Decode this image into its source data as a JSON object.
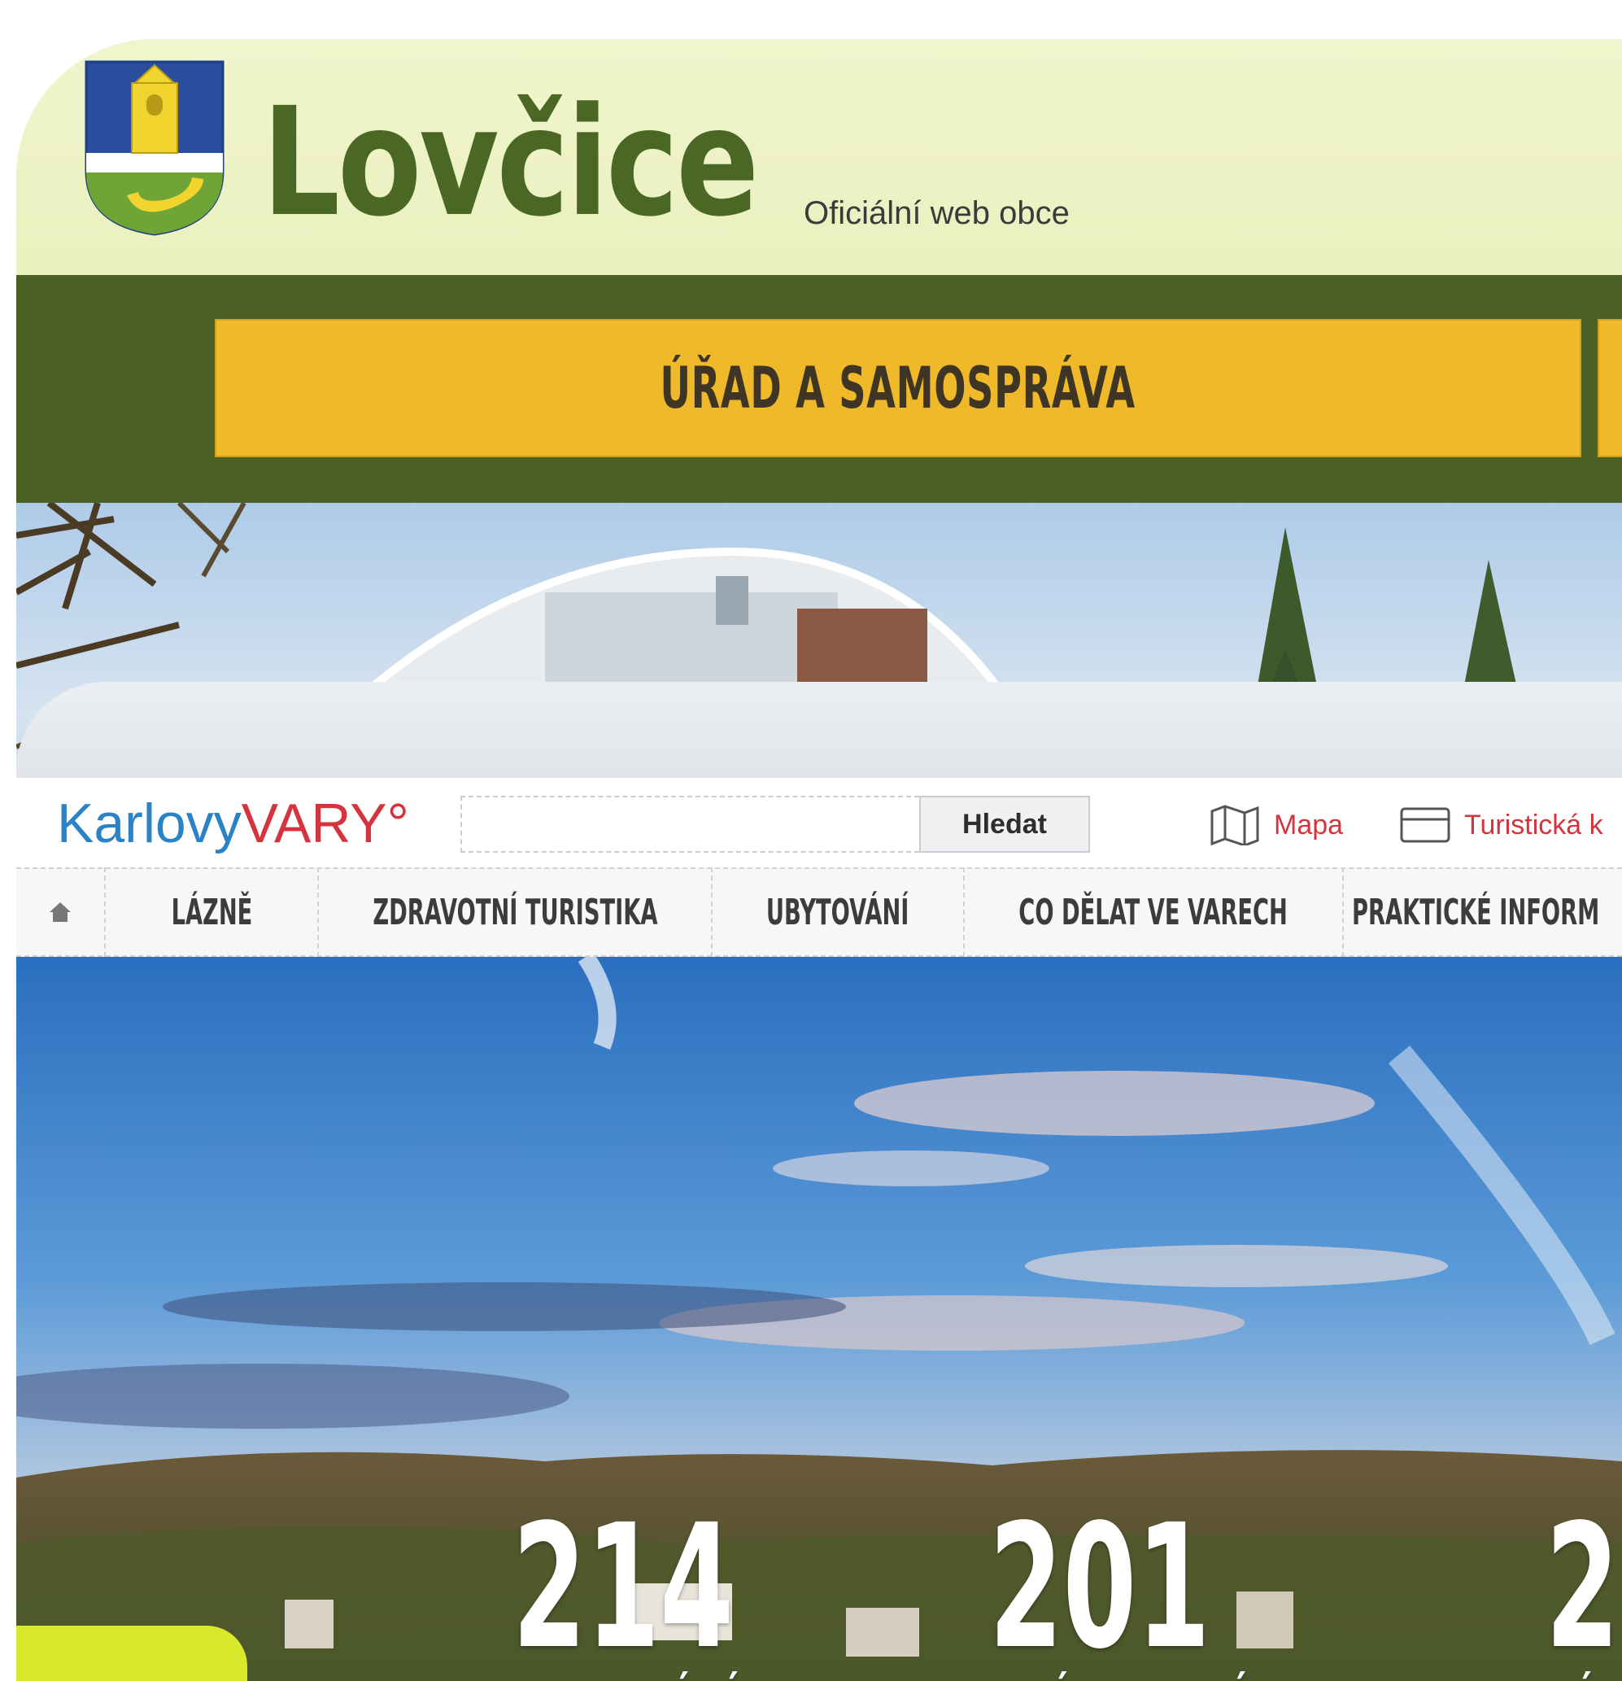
{
  "lovcice": {
    "title": "Lovčice",
    "subtitle": "Oficiální web obce",
    "nav_item": "ÚŘAD A SAMOSPRÁVA",
    "colors": {
      "header_bg": "#eef3c4",
      "title": "#4a6824",
      "nav_bar": "#4a6123",
      "nav_button": "#f0b929"
    }
  },
  "karlovy_vary": {
    "logo_part1": "Karlovy",
    "logo_part2": "VARY°",
    "search": {
      "button_label": "Hledat",
      "value": ""
    },
    "utility": {
      "map_label": "Mapa",
      "card_label": "Turistická k"
    },
    "nav": {
      "home_icon": "home-icon",
      "items": [
        "LÁZNĚ",
        "ZDRAVOTNÍ TURISTIKA",
        "UBYTOVÁNÍ",
        "CO DĚLAT VE VARECH",
        "PRAKTICKÉ INFORM"
      ]
    },
    "stats": [
      {
        "number": "214",
        "label": "UBYTOVÁNÍ"
      },
      {
        "number": "201",
        "label": "ZAJÍMAVOSTÍ"
      },
      {
        "number": "2",
        "label": "VÝL"
      }
    ],
    "colors": {
      "logo_blue": "#2b83c6",
      "logo_red": "#d4343e",
      "badge": "#d8e82a"
    }
  }
}
